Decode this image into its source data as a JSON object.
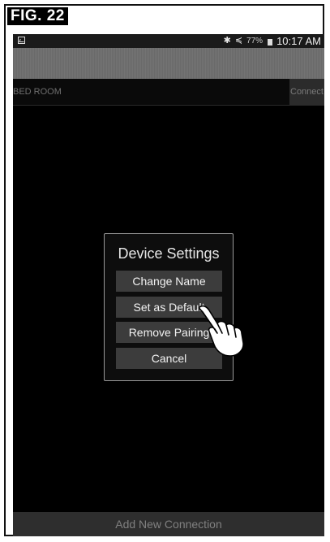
{
  "figure": {
    "label": "FIG. 22"
  },
  "status_bar": {
    "left_icon": "image-icon",
    "bluetooth_icon": "bluetooth-icon",
    "mute_icon": "vibrate-mute-icon",
    "battery_text": "77%",
    "time": "10:17 AM"
  },
  "device_list": {
    "row": {
      "name": "BED ROOM",
      "connect_label": "Connect"
    }
  },
  "dialog": {
    "title": "Device Settings",
    "buttons": {
      "change_name": "Change Name",
      "set_default": "Set as Default",
      "remove_pairing": "Remove Pairing",
      "cancel": "Cancel"
    },
    "pointer_icon": "pointing-hand-icon"
  },
  "footer": {
    "add_connection_label": "Add New Connection"
  }
}
